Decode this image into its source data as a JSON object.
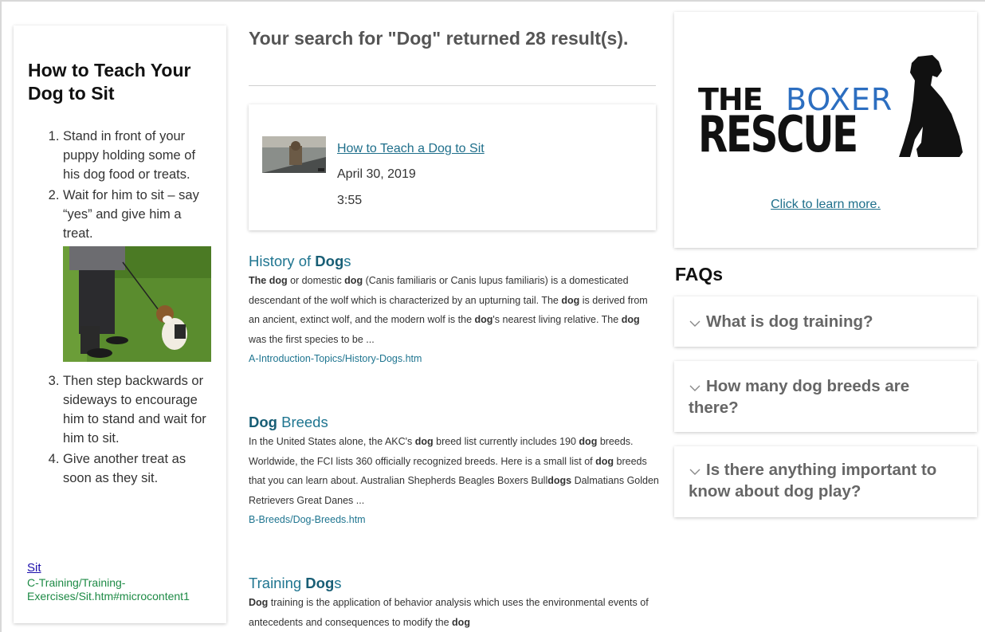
{
  "left_panel": {
    "title": "How to Teach Your Dog to Sit",
    "steps": [
      "Stand in front of your puppy holding some of his dog food or treats.",
      "Wait for him to sit – say “yes” and give him a treat.",
      "Then step backwards or sideways to encourage him to stand and wait for him to sit.",
      "Give another treat as soon as they sit."
    ],
    "link_label": "Sit",
    "link_path": "C-Training/Training-Exercises/Sit.htm#microcontent1"
  },
  "search": {
    "heading": "Your search for \"Dog\" returned 28 result(s)."
  },
  "video": {
    "title": "How to Teach a Dog to Sit",
    "date": "April 30, 2019",
    "duration": "3:55"
  },
  "results": [
    {
      "title_pre": "History of ",
      "title_bold": "Dog",
      "title_post": "s",
      "snippet": "The dog or domestic dog (Canis familiaris or Canis lupus familiaris) is a domesticated descendant of the wolf which is characterized by an upturning tail. The dog is derived from an ancient, extinct wolf, and the modern wolf is the dog's nearest living relative. The dog was the first species to be ...",
      "path": "A-Introduction-Topics/History-Dogs.htm"
    },
    {
      "title_pre": "",
      "title_bold": "Dog",
      "title_post": " Breeds",
      "snippet": "In the United States alone, the AKC's dog breed list currently includes 190 dog breeds. Worldwide, the FCI lists 360 officially recognized breeds. Here is a small list of dog breeds that you can learn about. Australian Shepherds Beagles Boxers Bulldogs Dalmatians Golden Retrievers Great Danes ...",
      "path": "B-Breeds/Dog-Breeds.htm"
    },
    {
      "title_pre": "Training ",
      "title_bold": "Dog",
      "title_post": "s",
      "snippet": "Dog training is the application of behavior analysis which uses the environmental events of antecedents and consequences to modify the dog",
      "path": ""
    }
  ],
  "ad": {
    "logo_the": "THE",
    "logo_boxer": "BOXER",
    "logo_rescue": "RESCUE",
    "link_label": "Click to learn more."
  },
  "faqs": {
    "title": "FAQs",
    "items": [
      "What is dog training?",
      "How many dog breeds are there?",
      "Is there anything important to know about dog play?"
    ]
  },
  "colors": {
    "link_teal": "#1f7590",
    "link_green": "#1d8a45",
    "logo_blue": "#2c6ec0"
  }
}
